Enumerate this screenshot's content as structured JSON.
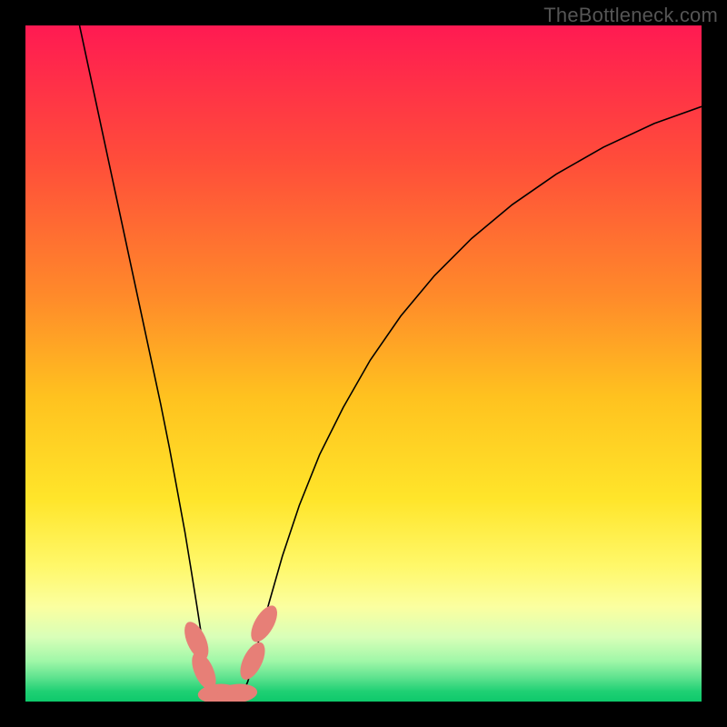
{
  "watermark": "TheBottleneck.com",
  "chart_data": {
    "type": "line",
    "title": "",
    "xlabel": "",
    "ylabel": "",
    "xlim": [
      0,
      100
    ],
    "ylim": [
      0,
      100
    ],
    "background": {
      "type": "vertical-gradient",
      "stops": [
        {
          "offset": 0.0,
          "color": "#ff1a52"
        },
        {
          "offset": 0.2,
          "color": "#ff4d3a"
        },
        {
          "offset": 0.4,
          "color": "#ff8a2a"
        },
        {
          "offset": 0.55,
          "color": "#ffc21f"
        },
        {
          "offset": 0.7,
          "color": "#ffe52a"
        },
        {
          "offset": 0.8,
          "color": "#fff86a"
        },
        {
          "offset": 0.86,
          "color": "#fbffa0"
        },
        {
          "offset": 0.905,
          "color": "#d8ffb8"
        },
        {
          "offset": 0.94,
          "color": "#a0f7a8"
        },
        {
          "offset": 0.965,
          "color": "#5de28e"
        },
        {
          "offset": 0.985,
          "color": "#1fd074"
        },
        {
          "offset": 1.0,
          "color": "#0ec96b"
        }
      ]
    },
    "series": [
      {
        "name": "curve",
        "style": {
          "stroke": "#000000",
          "width": 1.6
        },
        "points": [
          [
            8.0,
            100.0
          ],
          [
            9.5,
            93.0
          ],
          [
            11.0,
            86.0
          ],
          [
            12.5,
            79.0
          ],
          [
            14.0,
            72.0
          ],
          [
            15.5,
            65.0
          ],
          [
            17.0,
            58.0
          ],
          [
            18.5,
            51.0
          ],
          [
            20.0,
            44.0
          ],
          [
            21.3,
            37.5
          ],
          [
            22.5,
            31.0
          ],
          [
            23.6,
            25.0
          ],
          [
            24.5,
            19.5
          ],
          [
            25.3,
            14.5
          ],
          [
            26.0,
            10.0
          ],
          [
            26.6,
            6.0
          ],
          [
            27.2,
            3.0
          ],
          [
            27.8,
            1.3
          ],
          [
            28.5,
            0.5
          ],
          [
            29.5,
            0.3
          ],
          [
            30.5,
            0.3
          ],
          [
            31.5,
            0.5
          ],
          [
            32.2,
            1.3
          ],
          [
            32.9,
            3.0
          ],
          [
            33.6,
            5.5
          ],
          [
            34.5,
            9.0
          ],
          [
            36.0,
            14.5
          ],
          [
            38.0,
            21.5
          ],
          [
            40.5,
            29.0
          ],
          [
            43.5,
            36.5
          ],
          [
            47.0,
            43.5
          ],
          [
            51.0,
            50.5
          ],
          [
            55.5,
            57.0
          ],
          [
            60.5,
            63.0
          ],
          [
            66.0,
            68.5
          ],
          [
            72.0,
            73.5
          ],
          [
            78.5,
            78.0
          ],
          [
            85.5,
            82.0
          ],
          [
            93.0,
            85.5
          ],
          [
            100.0,
            88.0
          ]
        ]
      }
    ],
    "markers": [
      {
        "name": "left-marker-1",
        "cx": 25.3,
        "cy": 9.0,
        "rx": 1.4,
        "ry": 3.0,
        "angle": -24,
        "color": "#e77f77"
      },
      {
        "name": "left-marker-2",
        "cx": 26.4,
        "cy": 4.5,
        "rx": 1.4,
        "ry": 3.0,
        "angle": -24,
        "color": "#e77f77"
      },
      {
        "name": "bottom-marker-1",
        "cx": 28.5,
        "cy": 1.2,
        "rx": 1.4,
        "ry": 3.0,
        "angle": 85,
        "color": "#e77f77"
      },
      {
        "name": "bottom-marker-2",
        "cx": 31.3,
        "cy": 1.2,
        "rx": 1.4,
        "ry": 3.0,
        "angle": 85,
        "color": "#e77f77"
      },
      {
        "name": "right-marker-1",
        "cx": 33.6,
        "cy": 6.0,
        "rx": 1.4,
        "ry": 3.0,
        "angle": 26,
        "color": "#e77f77"
      },
      {
        "name": "right-marker-2",
        "cx": 35.3,
        "cy": 11.5,
        "rx": 1.4,
        "ry": 3.0,
        "angle": 30,
        "color": "#e77f77"
      }
    ]
  }
}
